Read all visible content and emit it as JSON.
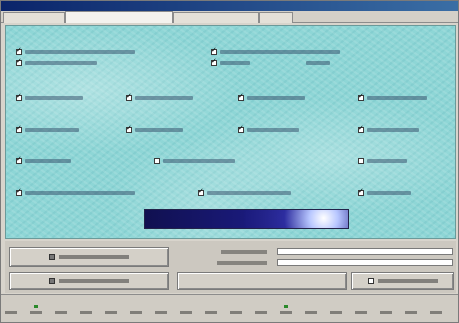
{
  "window": {
    "title": ""
  },
  "tabs": [
    {
      "label": "",
      "active": false
    },
    {
      "label": "",
      "active": true
    },
    {
      "label": "",
      "active": false
    },
    {
      "label": "",
      "active": false
    }
  ],
  "sections": [
    {
      "title": "",
      "items": [
        {
          "label": "",
          "checked": true
        },
        {
          "label": "",
          "checked": true
        },
        {
          "label": "",
          "checked": true
        },
        {
          "label": "",
          "checked": true
        }
      ]
    },
    {
      "title": "",
      "items": [
        {
          "label": "",
          "checked": true
        },
        {
          "label": "",
          "checked": true
        },
        {
          "label": "",
          "checked": true
        },
        {
          "label": "",
          "checked": true
        }
      ]
    },
    {
      "title": "",
      "items": [
        {
          "label": "",
          "checked": true
        },
        {
          "label": "",
          "checked": true
        },
        {
          "label": "",
          "checked": true
        },
        {
          "label": "",
          "checked": true
        }
      ]
    },
    {
      "title": "",
      "items": [
        {
          "label": "",
          "checked": true
        },
        {
          "label": "",
          "checked": false
        },
        {
          "label": "",
          "checked": false
        }
      ]
    },
    {
      "title": "",
      "items": [
        {
          "label": "",
          "checked": true
        },
        {
          "label": "",
          "checked": true
        },
        {
          "label": "",
          "checked": true
        }
      ]
    }
  ],
  "performance_banner": {
    "label": ""
  },
  "actions": {
    "run_button": {
      "label": ""
    },
    "save_button": {
      "label": ""
    },
    "standard_button": {
      "label": ""
    },
    "field_1_label": "",
    "field_2_label": ""
  },
  "statusbar": {
    "group_left": "",
    "group_right": "",
    "cells": [
      "",
      "",
      "",
      "",
      "",
      "",
      "",
      "",
      "",
      "",
      "",
      "",
      "",
      "",
      "",
      "",
      "",
      ""
    ]
  },
  "colors": {
    "panel_background": "#8ed6d6",
    "section_title": "#0a2a6a",
    "banner_background": "#1a1a7a",
    "titlebar": "#0a246a"
  }
}
